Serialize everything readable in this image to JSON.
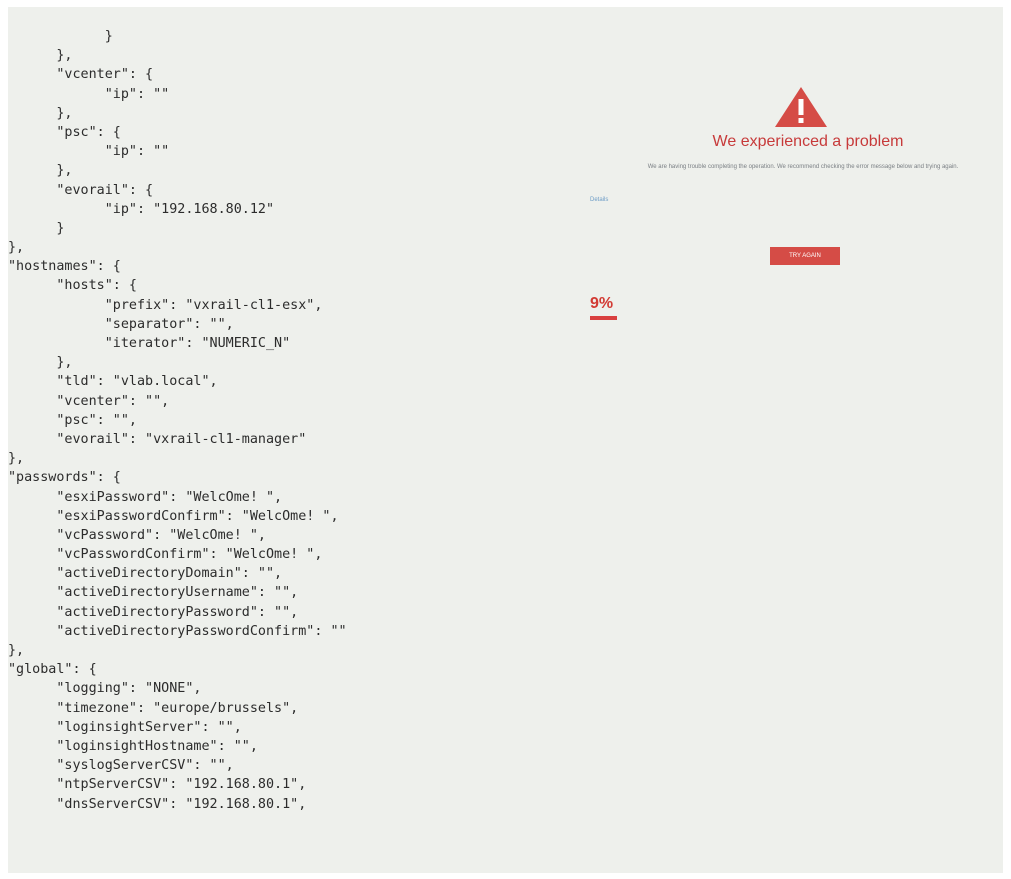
{
  "code_lines": [
    "            }",
    "      },",
    "      \"vcenter\": {",
    "            \"ip\": \"\"",
    "      },",
    "      \"psc\": {",
    "            \"ip\": \"\"",
    "      },",
    "      \"evorail\": {",
    "            \"ip\": \"192.168.80.12\"",
    "      }",
    "},",
    "\"hostnames\": {",
    "      \"hosts\": {",
    "            \"prefix\": \"vxrail-cl1-esx\",",
    "            \"separator\": \"\",",
    "            \"iterator\": \"NUMERIC_N\"",
    "      },",
    "      \"tld\": \"vlab.local\",",
    "      \"vcenter\": \"\",",
    "      \"psc\": \"\",",
    "      \"evorail\": \"vxrail-cl1-manager\"",
    "},",
    "\"passwords\": {",
    "      \"esxiPassword\": \"WelcOme! \",",
    "      \"esxiPasswordConfirm\": \"WelcOme! \",",
    "      \"vcPassword\": \"WelcOme! \",",
    "      \"vcPasswordConfirm\": \"WelcOme! \",",
    "      \"activeDirectoryDomain\": \"\",",
    "      \"activeDirectoryUsername\": \"\",",
    "      \"activeDirectoryPassword\": \"\",",
    "      \"activeDirectoryPasswordConfirm\": \"\"",
    "},",
    "\"global\": {",
    "      \"logging\": \"NONE\",",
    "      \"timezone\": \"europe/brussels\",",
    "      \"loginsightServer\": \"\",",
    "      \"loginsightHostname\": \"\",",
    "      \"syslogServerCSV\": \"\",",
    "      \"ntpServerCSV\": \"192.168.80.1\",",
    "      \"dnsServerCSV\": \"192.168.80.1\","
  ],
  "error": {
    "icon": "warning-triangle-icon",
    "title": "We experienced a problem",
    "message": "We are having trouble completing the operation. We recommend checking the error message below and trying again.",
    "link": "Details",
    "button_label": "TRY AGAIN"
  },
  "progress": {
    "label": "9%",
    "value_percent": 9
  },
  "colors": {
    "accent_red": "#d54c46",
    "screen_bg": "#eef0ec",
    "code_text": "#2c2c2c"
  }
}
